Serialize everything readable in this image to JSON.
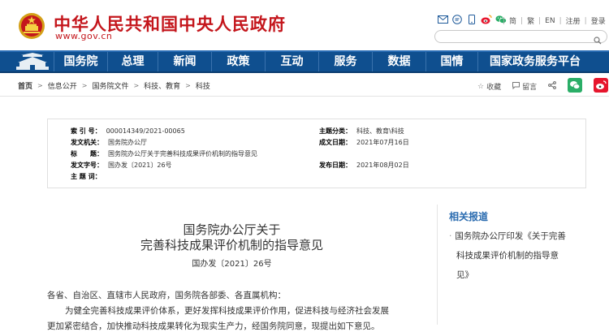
{
  "header": {
    "site_title": "中华人民共和国中央人民政府",
    "site_url": "www.gov.cn",
    "icons": [
      "mail-icon",
      "message-icon",
      "mobile-icon",
      "weibo-icon",
      "wechat-icon"
    ],
    "links": [
      "简",
      "繁",
      "EN",
      "注册",
      "登录"
    ],
    "search_placeholder": ""
  },
  "nav": {
    "items": [
      "国务院",
      "总理",
      "新闻",
      "政策",
      "互动",
      "服务",
      "数据",
      "国情",
      "国家政务服务平台"
    ]
  },
  "breadcrumb": [
    "首页",
    "信息公开",
    "国务院文件",
    "科技、教育",
    "科技"
  ],
  "share": {
    "favorite": "收藏",
    "comment": "留言"
  },
  "meta": {
    "index_no_label": "索 引 号：",
    "index_no": "000014349/2021-00065",
    "category_label": "主题分类：",
    "category": "科技、教育\\科技",
    "issuer_label": "发文机关：",
    "issuer": "国务院办公厅",
    "created_label": "成文日期：",
    "created": "2021年07月16日",
    "title_label": "标　　题：",
    "title": "国务院办公厅关于完善科技成果评价机制的指导意见",
    "docno_label": "发文字号：",
    "docno": "国办发〔2021〕26号",
    "published_label": "发布日期：",
    "published": "2021年08月02日",
    "keywords_label": "主 题 词：",
    "keywords": ""
  },
  "article": {
    "title_line1": "国务院办公厅关于",
    "title_line2": "完善科技成果评价机制的指导意见",
    "doc_number": "国办发〔2021〕26号",
    "para1": "各省、自治区、直辖市人民政府，国务院各部委、各直属机构：",
    "para2": "为健全完善科技成果评价体系，更好发挥科技成果评价作用，促进科技与经济社会发展",
    "para3": "更加紧密结合，加快推动科技成果转化为现实生产力，经国务院同意，现提出如下意见。"
  },
  "sidebar": {
    "title": "相关报道",
    "link_line1": "国务院办公厅印发《关于完善",
    "link_line2": "科技成果评价机制的指导意",
    "link_line3": "见》"
  },
  "colors": {
    "brand_red": "#c4161c",
    "nav_blue": "#0f4f8f",
    "link_blue": "#2b6cb0"
  }
}
